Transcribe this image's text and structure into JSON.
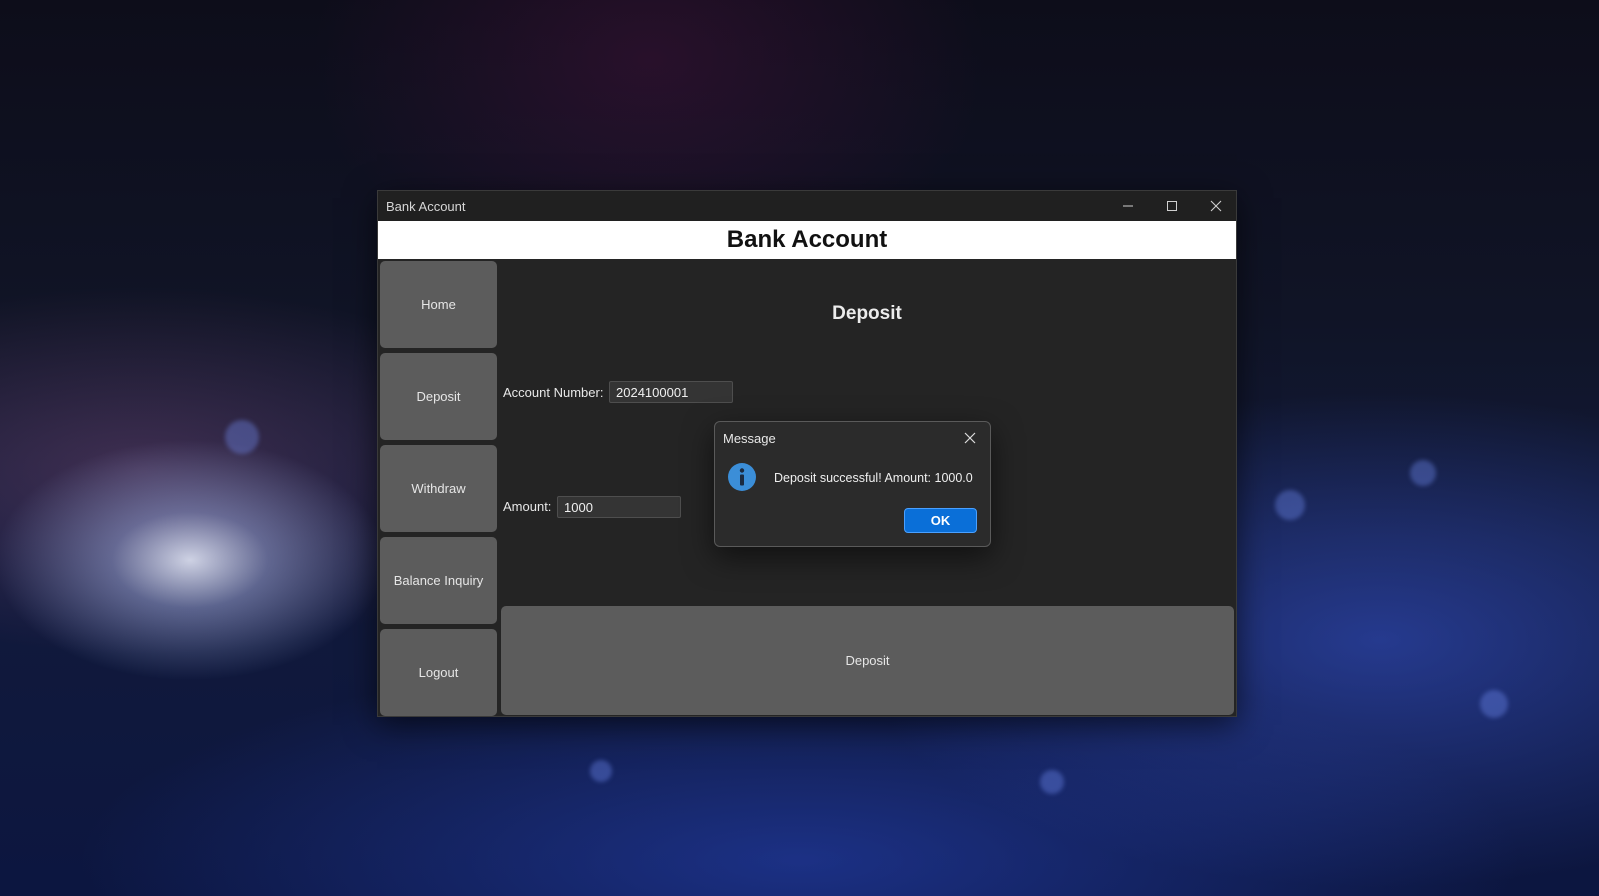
{
  "window": {
    "title": "Bank Account",
    "controls": {
      "minimize_icon": "minimize-icon",
      "maximize_icon": "maximize-icon",
      "close_icon": "close-icon"
    }
  },
  "header": {
    "title": "Bank Account"
  },
  "sidebar": {
    "items": [
      {
        "label": "Home"
      },
      {
        "label": "Deposit"
      },
      {
        "label": "Withdraw"
      },
      {
        "label": "Balance Inquiry"
      },
      {
        "label": "Logout"
      }
    ]
  },
  "main": {
    "title": "Deposit",
    "account_number": {
      "label": "Account Number:",
      "value": "2024100001"
    },
    "amount": {
      "label": "Amount:",
      "value": "1000"
    },
    "submit_label": "Deposit"
  },
  "dialog": {
    "title": "Message",
    "icon": "info-icon",
    "message": "Deposit successful! Amount: 1000.0",
    "ok_label": "OK"
  },
  "colors": {
    "window_bg": "#242424",
    "button_bg": "#5c5c5c",
    "header_bg": "#ffffff",
    "ok_button": "#0a6fd8",
    "info_icon": "#3b8ed8"
  }
}
